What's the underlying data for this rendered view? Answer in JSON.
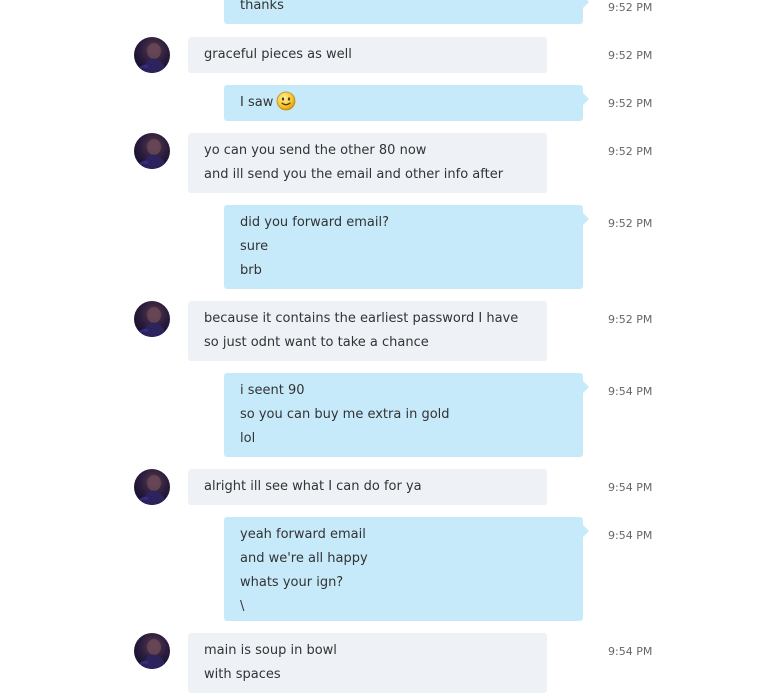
{
  "colors": {
    "incoming_bubble": "#eef1f6",
    "outgoing_bubble": "#c7eafb",
    "timestamp": "#666666",
    "text": "#333333"
  },
  "messages": [
    {
      "direction": "out",
      "lines": [
        "thanks"
      ],
      "time": "9:52 PM"
    },
    {
      "direction": "in",
      "avatar": "user-avatar",
      "lines": [
        "graceful pieces as well"
      ],
      "time": "9:52 PM"
    },
    {
      "direction": "out",
      "lines": [
        "I saw"
      ],
      "emoji": "smile-emoji-icon",
      "time": "9:52 PM"
    },
    {
      "direction": "in",
      "avatar": "user-avatar",
      "lines": [
        "yo can you send the other 80 now",
        "and ill send you the email and other info after"
      ],
      "time": "9:52 PM"
    },
    {
      "direction": "out",
      "lines": [
        "did you forward email?",
        "sure",
        "brb"
      ],
      "time": "9:52 PM"
    },
    {
      "direction": "in",
      "avatar": "user-avatar",
      "lines": [
        "because it contains the earliest password I have",
        "so just odnt want to take a chance"
      ],
      "time": "9:52 PM"
    },
    {
      "direction": "out",
      "lines": [
        "i seent 90",
        "so you can buy me extra in gold",
        "lol"
      ],
      "time": "9:54 PM"
    },
    {
      "direction": "in",
      "avatar": "user-avatar",
      "lines": [
        "alright ill see what I can do for ya"
      ],
      "time": "9:54 PM"
    },
    {
      "direction": "out",
      "lines": [
        "yeah forward email",
        "and we're all happy",
        "whats your ign?",
        "\\"
      ],
      "time": "9:54 PM"
    },
    {
      "direction": "in",
      "avatar": "user-avatar",
      "lines": [
        "main is soup in bowl",
        "with spaces"
      ],
      "time": "9:54 PM"
    }
  ]
}
